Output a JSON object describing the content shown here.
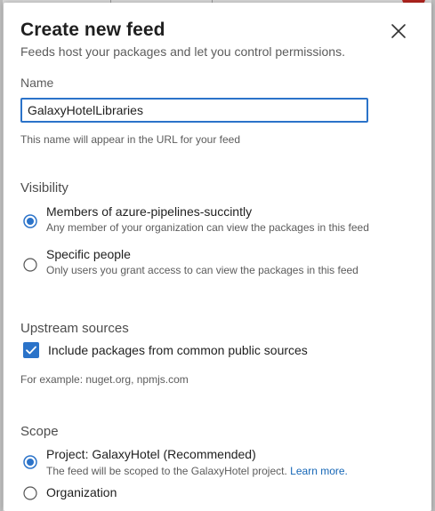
{
  "dialog": {
    "title": "Create new feed",
    "subtitle": "Feeds host your packages and let you control permissions.",
    "close_icon": "close-icon"
  },
  "name_section": {
    "label": "Name",
    "value": "GalaxyHotelLibraries",
    "helper": "This name will appear in the URL for your feed"
  },
  "visibility": {
    "heading": "Visibility",
    "options": [
      {
        "title": "Members of azure-pipelines-succintly",
        "description": "Any member of your organization can view the packages in this feed",
        "selected": true
      },
      {
        "title": "Specific people",
        "description": "Only users you grant access to can view the packages in this feed",
        "selected": false
      }
    ]
  },
  "upstream": {
    "heading": "Upstream sources",
    "checkbox_label": "Include packages from common public sources",
    "checked": true,
    "example": "For example: nuget.org, npmjs.com"
  },
  "scope": {
    "heading": "Scope",
    "options": [
      {
        "title": "Project: GalaxyHotel (Recommended)",
        "description": "The feed will be scoped to the GalaxyHotel project.",
        "link": "Learn more.",
        "selected": true
      },
      {
        "title": "Organization",
        "selected": false
      }
    ]
  },
  "colors": {
    "accent": "#2b73c9",
    "link": "#1566b6",
    "text": "#1f1f1f",
    "muted": "#5c5c5c"
  }
}
